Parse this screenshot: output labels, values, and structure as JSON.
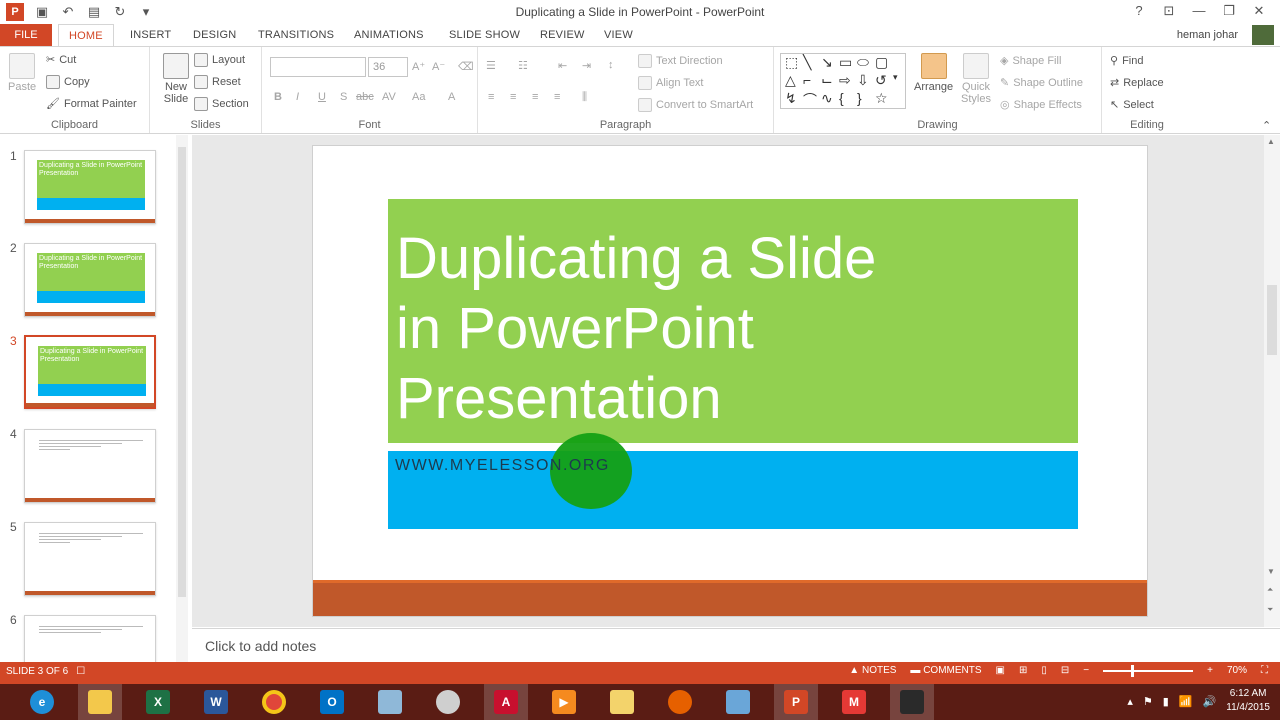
{
  "window": {
    "title": "Duplicating a Slide in PowerPoint - PowerPoint",
    "help": "?",
    "minimize": "—",
    "restore": "❐",
    "close": "✕"
  },
  "tabs": {
    "file": "FILE",
    "items": [
      "HOME",
      "INSERT",
      "DESIGN",
      "TRANSITIONS",
      "ANIMATIONS",
      "SLIDE SHOW",
      "REVIEW",
      "VIEW"
    ],
    "user": "heman johar"
  },
  "ribbon": {
    "clipboard": {
      "label": "Clipboard",
      "paste": "Paste",
      "cut": "Cut",
      "copy": "Copy",
      "format_painter": "Format Painter"
    },
    "slides": {
      "label": "Slides",
      "new_slide": "New Slide",
      "layout": "Layout",
      "reset": "Reset",
      "section": "Section"
    },
    "font": {
      "label": "Font",
      "size": "36",
      "bold": "B",
      "italic": "I",
      "underline": "U",
      "shadow": "S",
      "strike": "abc",
      "spacing": "AV",
      "case": "Aa",
      "color": "A"
    },
    "paragraph": {
      "label": "Paragraph",
      "text_direction": "Text Direction",
      "align_text": "Align Text",
      "smartart": "Convert to SmartArt"
    },
    "drawing": {
      "label": "Drawing",
      "arrange": "Arrange",
      "quick_styles": "Quick Styles",
      "shape_fill": "Shape Fill",
      "shape_outline": "Shape Outline",
      "shape_effects": "Shape Effects"
    },
    "editing": {
      "label": "Editing",
      "find": "Find",
      "replace": "Replace",
      "select": "Select"
    }
  },
  "thumbnails": [
    {
      "num": "1",
      "title": "Duplicating a Slide in PowerPoint Presentation",
      "kind": "title"
    },
    {
      "num": "2",
      "title": "Duplicating a Slide in PowerPoint Presentation",
      "kind": "title"
    },
    {
      "num": "3",
      "title": "Duplicating a Slide in PowerPoint Presentation",
      "kind": "title",
      "selected": true
    },
    {
      "num": "4",
      "kind": "text"
    },
    {
      "num": "5",
      "kind": "text"
    },
    {
      "num": "6",
      "kind": "text"
    }
  ],
  "slide": {
    "title_line1": "Duplicating a Slide",
    "title_line2": "in PowerPoint",
    "title_line3": "Presentation",
    "subtitle": "WWW.MYELESSON.ORG"
  },
  "notes": {
    "placeholder": "Click to add notes"
  },
  "status": {
    "slide_info": "SLIDE 3 OF 6",
    "notes": "NOTES",
    "comments": "COMMENTS",
    "zoom": "70%"
  },
  "taskbar": {
    "time": "6:12 AM",
    "date": "11/4/2015"
  },
  "colors": {
    "accent": "#d24726",
    "slide_green": "#92d050",
    "slide_blue": "#00b0f0",
    "slide_footer": "#c0582a"
  }
}
